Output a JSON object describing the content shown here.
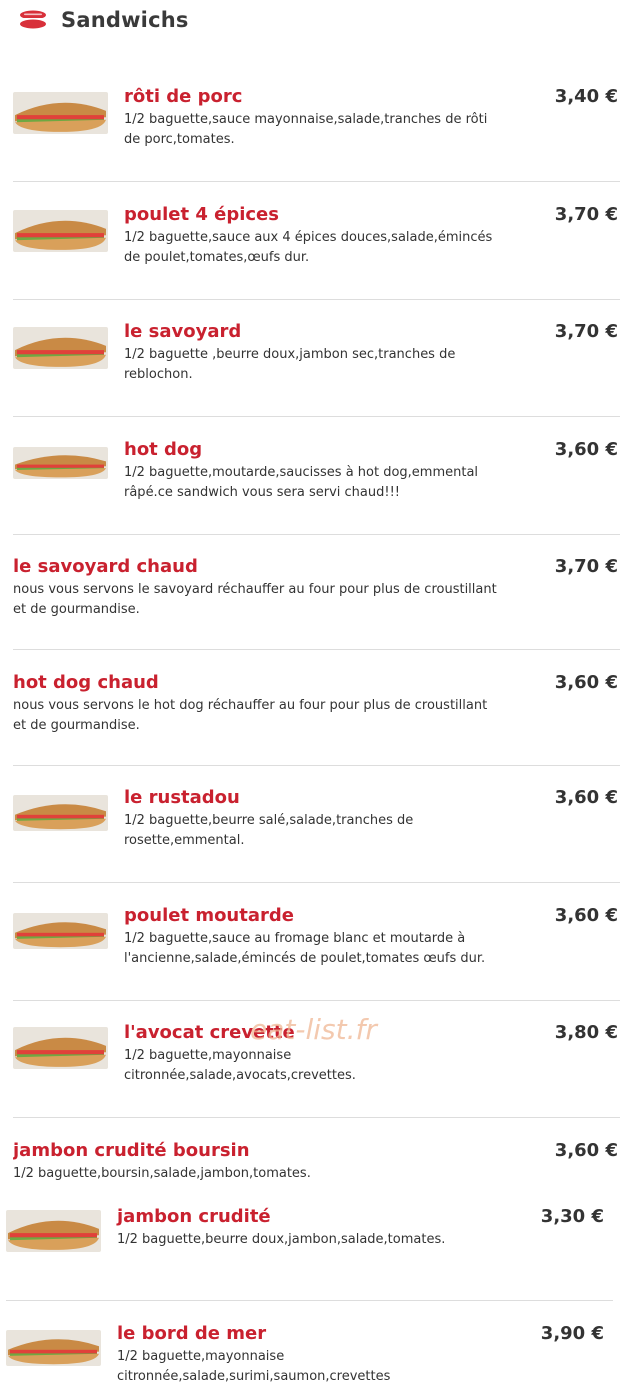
{
  "section": {
    "title": "Sandwichs",
    "icon": "sandwich-icon"
  },
  "items": [
    {
      "name": "rôti de porc",
      "price": "3,40 €",
      "desc": "1/2 baguette,sauce mayonnaise,salade,tranches de rôti de porc,tomates.",
      "image": true
    },
    {
      "name": "poulet 4 épices",
      "price": "3,70 €",
      "desc": "1/2 baguette,sauce aux 4 épices douces,salade,émincés de poulet,tomates,œufs dur.",
      "image": true
    },
    {
      "name": "le savoyard",
      "price": "3,70 €",
      "desc": "1/2 baguette ,beurre doux,jambon sec,tranches de reblochon.",
      "image": true
    },
    {
      "name": "hot dog",
      "price": "3,60 €",
      "desc": "1/2 baguette,moutarde,saucisses à hot dog,emmental râpé.ce sandwich vous sera servi chaud!!!",
      "image": true
    },
    {
      "name": "le savoyard chaud",
      "price": "3,70 €",
      "desc": "nous vous servons le savoyard réchauffer au four pour plus de croustillant et de gourmandise.",
      "image": false
    },
    {
      "name": "hot dog chaud",
      "price": "3,60 €",
      "desc": "nous vous servons le hot dog réchauffer au four pour plus de croustillant et de gourmandise.",
      "image": false
    },
    {
      "name": "le rustadou",
      "price": "3,60 €",
      "desc": "1/2 baguette,beurre salé,salade,tranches de rosette,emmental.",
      "image": true
    },
    {
      "name": "poulet moutarde",
      "price": "3,60 €",
      "desc": "1/2 baguette,sauce au fromage blanc et moutarde à l'ancienne,salade,émincés de poulet,tomates œufs dur.",
      "image": true
    },
    {
      "name": "l'avocat crevette",
      "price": "3,80 €",
      "desc": "1/2 baguette,mayonnaise citronnée,salade,avocats,crevettes.",
      "image": true
    },
    {
      "name": "jambon crudité boursin",
      "price": "3,60 €",
      "desc": "1/2 baguette,boursin,salade,jambon,tomates.",
      "image": false
    },
    {
      "name": "jambon crudité",
      "price": "3,30 €",
      "desc": "1/2 baguette,beurre doux,jambon,salade,tomates.",
      "image": true
    },
    {
      "name": "le bord de mer",
      "price": "3,90 €",
      "desc": "1/2 baguette,mayonnaise citronnée,salade,surimi,saumon,crevettes",
      "image": true
    }
  ],
  "watermark": "eat-list.fr",
  "colors": {
    "item_name": "#c9212f",
    "text": "#333333",
    "divider": "#dddddd",
    "watermark": "#f0b795"
  }
}
